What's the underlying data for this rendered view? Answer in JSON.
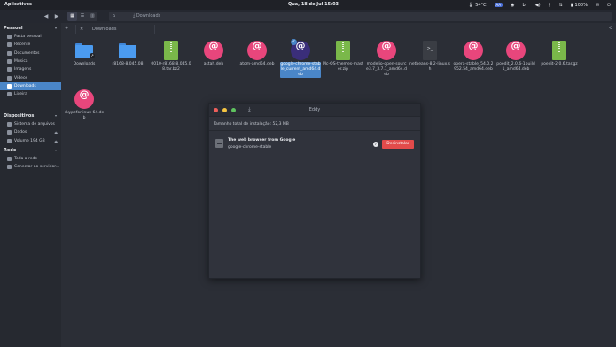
{
  "topbar": {
    "apps_label": "Aplicativos",
    "clock": "Qua, 18 de Jul   15:03",
    "temperature": "54°C",
    "keyboard_layout": "br",
    "battery": "100%",
    "badge": "AA"
  },
  "toolbar": {
    "back_icon": "arrow-left-icon",
    "forward_icon": "arrow-right-icon",
    "view_modes": [
      "icon-view",
      "list-view",
      "column-view"
    ],
    "path": {
      "home_icon": "home-icon",
      "crumb": "Downloads"
    }
  },
  "tabs": {
    "items": [
      {
        "label": "Downloads"
      }
    ]
  },
  "sidebar": {
    "sections": [
      {
        "title": "Pessoal",
        "items": [
          {
            "label": "Pasta pessoal",
            "icon": "home-icon"
          },
          {
            "label": "Recente",
            "icon": "clock-icon"
          },
          {
            "label": "Documentos",
            "icon": "document-icon"
          },
          {
            "label": "Música",
            "icon": "music-icon"
          },
          {
            "label": "Imagens",
            "icon": "image-icon"
          },
          {
            "label": "Vídeos",
            "icon": "video-icon"
          },
          {
            "label": "Downloads",
            "icon": "download-icon",
            "active": true
          },
          {
            "label": "Lixeira",
            "icon": "trash-icon"
          }
        ]
      },
      {
        "title": "Dispositivos",
        "items": [
          {
            "label": "Sistema de arquivos",
            "icon": "drive-icon"
          },
          {
            "label": "Dados",
            "icon": "drive-icon"
          },
          {
            "label": "Volume 194 GB",
            "icon": "drive-icon"
          }
        ]
      },
      {
        "title": "Rede",
        "items": [
          {
            "label": "Toda a rede",
            "icon": "network-icon"
          },
          {
            "label": "Conectar ao servidor...",
            "icon": "server-icon"
          }
        ]
      }
    ]
  },
  "files": [
    {
      "label": "Downloads",
      "type": "folder",
      "link": true
    },
    {
      "label": "r8168-8.045.08",
      "type": "folder"
    },
    {
      "label": "0010-r8168-8.045.08.tar.bz2",
      "type": "zip"
    },
    {
      "label": "astah.deb",
      "type": "deb"
    },
    {
      "label": "atom-amd64.deb",
      "type": "deb"
    },
    {
      "label": "google-chrome-stable_current_amd64.deb",
      "type": "deb-dark",
      "selected": true
    },
    {
      "label": "Mc-OS-themes-master.zip",
      "type": "zip"
    },
    {
      "label": "modelio-open-source3.7_3.7.1_amd64.deb",
      "type": "deb"
    },
    {
      "label": "netbeans-8.2-linux.sh",
      "type": "sh"
    },
    {
      "label": "opera-stable_54.0.2952.54_amd64.deb",
      "type": "deb"
    },
    {
      "label": "poedit_2.0.6-1build1_amd64.deb",
      "type": "deb"
    },
    {
      "label": "poedit-2.0.6.tar.gz",
      "type": "zip"
    },
    {
      "label": "skypeforlinux-64.deb",
      "type": "deb"
    }
  ],
  "dialog": {
    "title": "Eddy",
    "total_size": "Tamanho total de instalação: 52,3 MB",
    "package": {
      "description": "The web browser from Google",
      "name": "google-chrome-stable",
      "button_label": "Desinstalar"
    },
    "colors": {
      "close": "#ee5f5b",
      "minimize": "#f5c542",
      "maximize": "#5fc35f",
      "button": "#e34b4b"
    }
  }
}
